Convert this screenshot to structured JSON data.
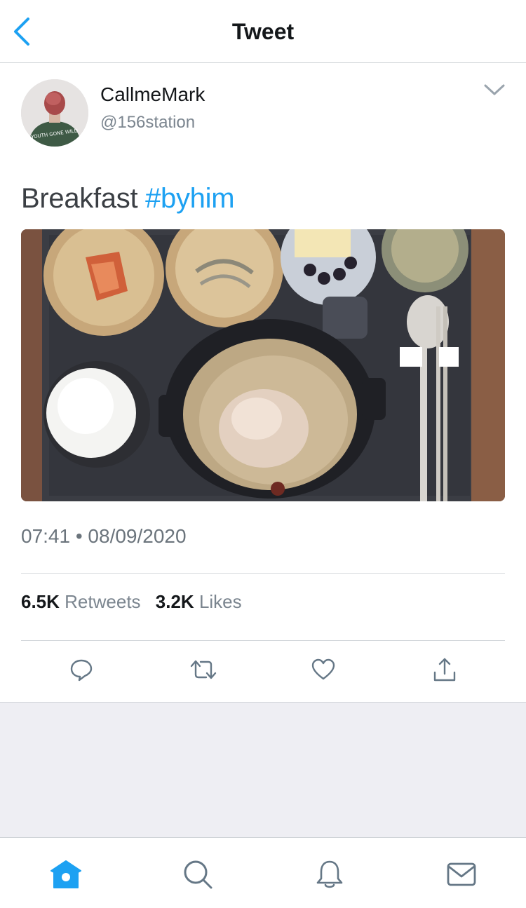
{
  "header": {
    "title": "Tweet",
    "back_icon": "chevron-left-icon"
  },
  "tweet": {
    "author": {
      "display_name": "CallmeMark",
      "handle": "@156station"
    },
    "text": {
      "body": "Breakfast ",
      "hashtag": "#byhim"
    },
    "timestamp": "07:41 • 08/09/2020",
    "stats": {
      "retweets_count": "6.5K",
      "retweets_label": "Retweets",
      "likes_count": "3.2K",
      "likes_label": "Likes"
    },
    "actions": [
      "reply-icon",
      "retweet-icon",
      "like-icon",
      "share-icon"
    ]
  },
  "tabbar": {
    "items": [
      "home-icon",
      "search-icon",
      "notifications-icon",
      "messages-icon"
    ]
  },
  "colors": {
    "accent": "#1da1f2",
    "icon_gray": "#657786",
    "text_primary": "#14171a",
    "text_secondary": "#7b858f",
    "background_gray": "#eeeef3"
  }
}
